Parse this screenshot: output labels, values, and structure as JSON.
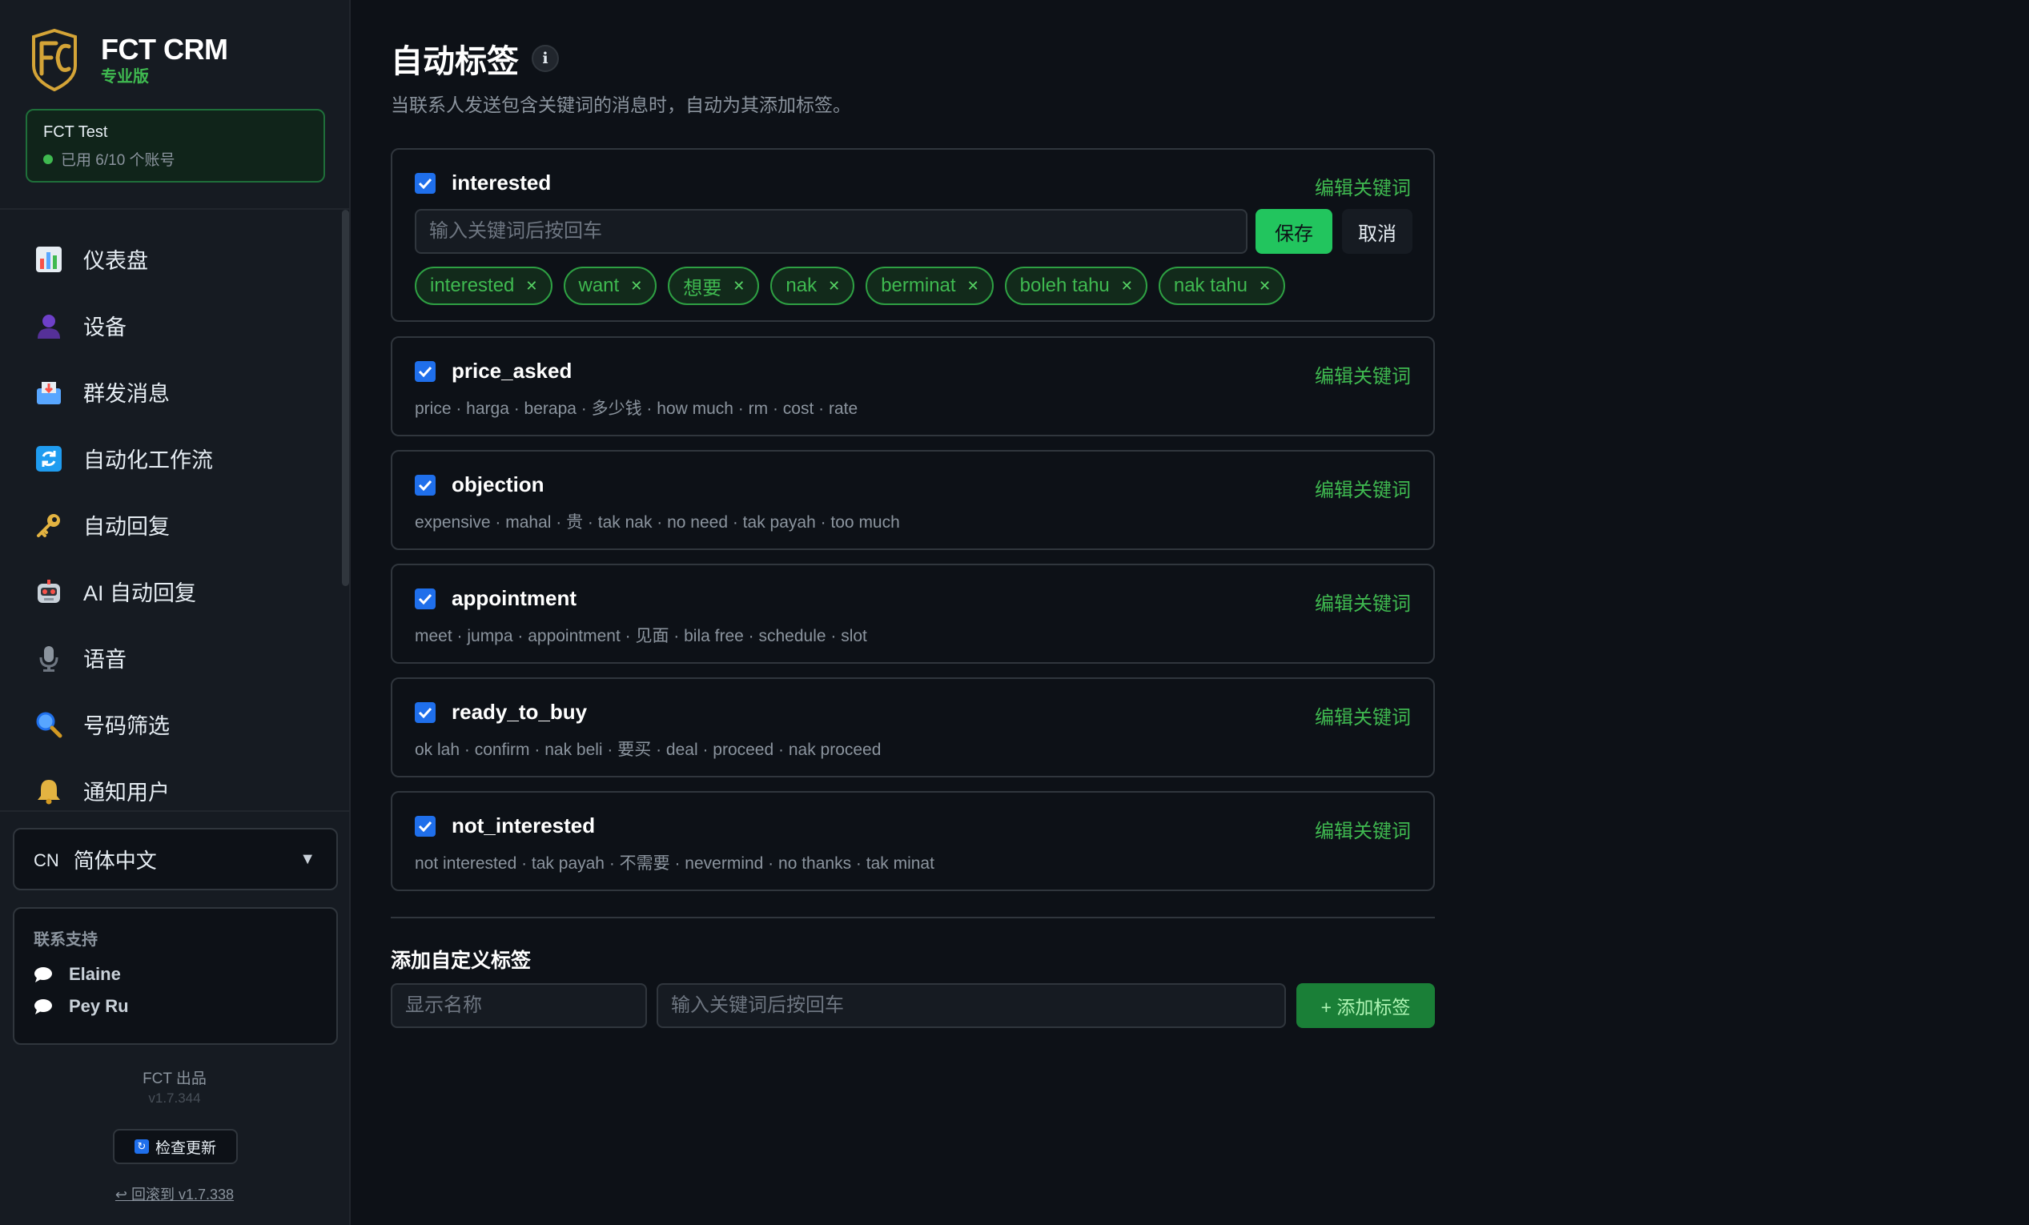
{
  "brand": {
    "name": "FCT CRM",
    "edition": "专业版"
  },
  "account": {
    "name": "FCT Test",
    "status": "已用 6/10 个账号"
  },
  "nav": [
    {
      "label": "仪表盘",
      "icon": "chart-icon"
    },
    {
      "label": "设备",
      "icon": "user-icon"
    },
    {
      "label": "群发消息",
      "icon": "inbox-icon"
    },
    {
      "label": "自动化工作流",
      "icon": "refresh-icon"
    },
    {
      "label": "自动回复",
      "icon": "key-icon"
    },
    {
      "label": "AI 自动回复",
      "icon": "robot-icon"
    },
    {
      "label": "语音",
      "icon": "microphone-icon"
    },
    {
      "label": "号码筛选",
      "icon": "magnifier-icon"
    },
    {
      "label": "通知用户",
      "icon": "bell-icon"
    }
  ],
  "language": {
    "code": "CN",
    "label": "简体中文"
  },
  "support": {
    "title": "联系支持",
    "contacts": [
      "Elaine",
      "Pey Ru"
    ]
  },
  "footer": {
    "by": "FCT 出品",
    "version": "v1.7.344",
    "check_update": "检查更新",
    "rollback": "↩ 回滚到 v1.7.338"
  },
  "page": {
    "title": "自动标签",
    "subtitle": "当联系人发送包含关键词的消息时，自动为其添加标签。"
  },
  "edit_label": "编辑关键词",
  "editor": {
    "placeholder": "输入关键词后按回车",
    "save": "保存",
    "cancel": "取消"
  },
  "tags": [
    {
      "name": "interested",
      "checked": true,
      "editing": true,
      "chips": [
        "interested",
        "want",
        "想要",
        "nak",
        "berminat",
        "boleh tahu",
        "nak tahu"
      ]
    },
    {
      "name": "price_asked",
      "checked": true,
      "keywords": "price · harga · berapa · 多少钱 · how much · rm · cost · rate"
    },
    {
      "name": "objection",
      "checked": true,
      "keywords": "expensive · mahal · 贵 · tak nak · no need · tak payah · too much"
    },
    {
      "name": "appointment",
      "checked": true,
      "keywords": "meet · jumpa · appointment · 见面 · bila free · schedule · slot"
    },
    {
      "name": "ready_to_buy",
      "checked": true,
      "keywords": "ok lah · confirm · nak beli · 要买 · deal · proceed · nak proceed"
    },
    {
      "name": "not_interested",
      "checked": true,
      "keywords": "not interested · tak payah · 不需要 · nevermind · no thanks · tak minat"
    }
  ],
  "add_custom": {
    "title": "添加自定义标签",
    "name_placeholder": "显示名称",
    "keywords_placeholder": "输入关键词后按回车",
    "button": "+ 添加标签"
  },
  "colors": {
    "accent": "#3fb950",
    "primary_check": "#1f6feb",
    "background": "#0d1117"
  }
}
